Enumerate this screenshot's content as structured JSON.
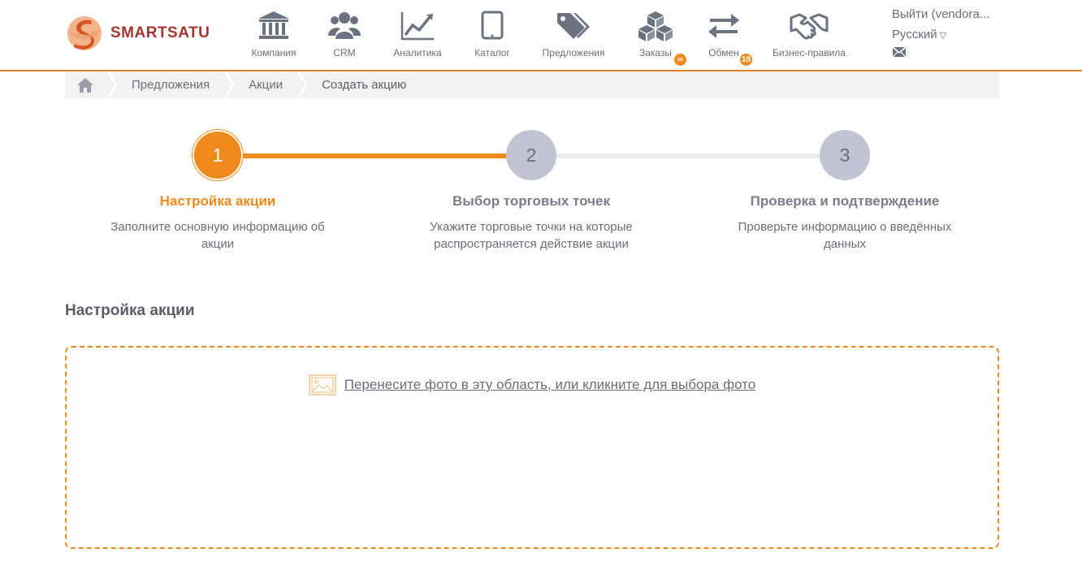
{
  "brand": {
    "name": "SMARTSATU",
    "color": "#a7342f"
  },
  "nav": {
    "items": [
      {
        "label": "Компания",
        "icon": "bank-icon"
      },
      {
        "label": "CRM",
        "icon": "users-icon"
      },
      {
        "label": "Аналитика",
        "icon": "line-chart-icon"
      },
      {
        "label": "Каталог",
        "icon": "tablet-icon"
      },
      {
        "label": "Предложения",
        "icon": "tags-icon"
      },
      {
        "label": "Заказы",
        "icon": "cubes-icon",
        "badge": "∞"
      },
      {
        "label": "Обмен",
        "icon": "exchange-icon",
        "badge": "18"
      },
      {
        "label": "Бизнес-правила",
        "icon": "handshake-icon"
      }
    ]
  },
  "user": {
    "logout_label": "Выйти (vendora...",
    "language": "Русский",
    "language_caret": "▽",
    "mail_icon": "envelope-icon"
  },
  "breadcrumb": {
    "home_icon": "home-icon",
    "items": [
      "Предложения",
      "Акции",
      "Создать акцию"
    ]
  },
  "stepper": {
    "steps": [
      {
        "number": "1",
        "title": "Настройка акции",
        "description": "Заполните основную информацию об акции",
        "state": "active"
      },
      {
        "number": "2",
        "title": "Выбор торговых точек",
        "description": "Укажите торговые точки на которые распространяется действие акции",
        "state": "pending"
      },
      {
        "number": "3",
        "title": "Проверка и подтверждение",
        "description": "Проверьте информацию о введённых данных",
        "state": "pending"
      }
    ]
  },
  "section": {
    "title": "Настройка акции"
  },
  "upload": {
    "icon": "image-icon",
    "text": "Перенесите фото в эту область, или кликните для выбора фото"
  },
  "colors": {
    "accent": "#f08a1c",
    "inactive_step": "#c2c4d4",
    "text": "#6b6e7a"
  }
}
